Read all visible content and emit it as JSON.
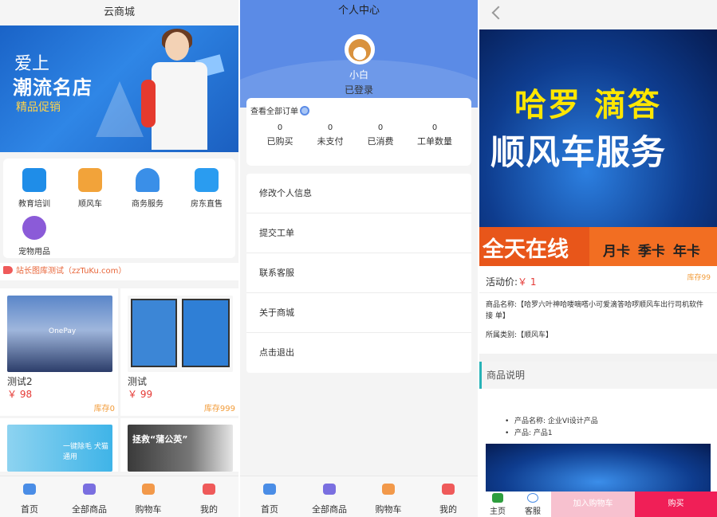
{
  "shop": {
    "title": "云商城",
    "banner": {
      "line1": "爱上",
      "line2": "潮流名店",
      "line3": "精品促销"
    },
    "categories": [
      {
        "label": "教育培训",
        "icon": "education-icon",
        "color": "#1f8de8"
      },
      {
        "label": "顺风车",
        "icon": "car-icon",
        "color": "#f2a33a"
      },
      {
        "label": "商务服务",
        "icon": "business-icon",
        "color": "#3a8fe8"
      },
      {
        "label": "房东直售",
        "icon": "house-icon",
        "color": "#2a9cf0"
      },
      {
        "label": "宠物用品",
        "icon": "paw-icon",
        "color": "#8b5bd8"
      }
    ],
    "notice": "站长图库测试（zzTuKu.com）",
    "products": [
      {
        "name": "测试2",
        "price": "￥ 98",
        "stock": "库存0",
        "img_text": "OnePay"
      },
      {
        "name": "测试",
        "price": "￥ 99",
        "stock": "库存999",
        "img_text": ""
      },
      {
        "name": "",
        "price": "",
        "stock": "",
        "img_text": "一键除毛 犬猫通用"
      },
      {
        "name": "",
        "price": "",
        "stock": "",
        "img_text": "拯救“蒲公英”"
      }
    ]
  },
  "tabs": [
    {
      "label": "首页",
      "icon": "home-icon",
      "color": "#4a8de6"
    },
    {
      "label": "全部商品",
      "icon": "goods-icon",
      "color": "#7a6fe0"
    },
    {
      "label": "购物车",
      "icon": "cart-icon",
      "color": "#f2994a"
    },
    {
      "label": "我的",
      "icon": "user-icon",
      "color": "#ef5a5a"
    }
  ],
  "profile": {
    "title": "个人中心",
    "name": "小白",
    "status": "已登录",
    "orders_title": "查看全部订单",
    "stats": [
      {
        "value": "0",
        "label": "已购买"
      },
      {
        "value": "0",
        "label": "未支付"
      },
      {
        "value": "0",
        "label": "已消费"
      },
      {
        "value": "0",
        "label": "工单数量"
      }
    ],
    "menu": [
      "修改个人信息",
      "提交工单",
      "联系客服",
      "关于商城",
      "点击退出"
    ]
  },
  "detail": {
    "banner": {
      "line1": "哈罗  滴答",
      "line2": "顺风车服务",
      "line3": "全天在线",
      "line4": "月卡 季卡 年卡"
    },
    "price_label": "活动价:",
    "price": "￥ 1",
    "stock": "库存99",
    "product_name": "商品名称:【哈罗六叶神哈喽嘀嗒小可爱滴答哈啰顺风车出行司机软件接 单】",
    "category": "所属类别:【顺风车】",
    "desc_title": "商品说明",
    "desc_items": [
      "产品名称: 企业VI设计产品",
      "产品: 产品1"
    ],
    "bar": {
      "home": "主页",
      "service": "客服",
      "add_cart": "加入购物车",
      "buy": "购买"
    }
  }
}
